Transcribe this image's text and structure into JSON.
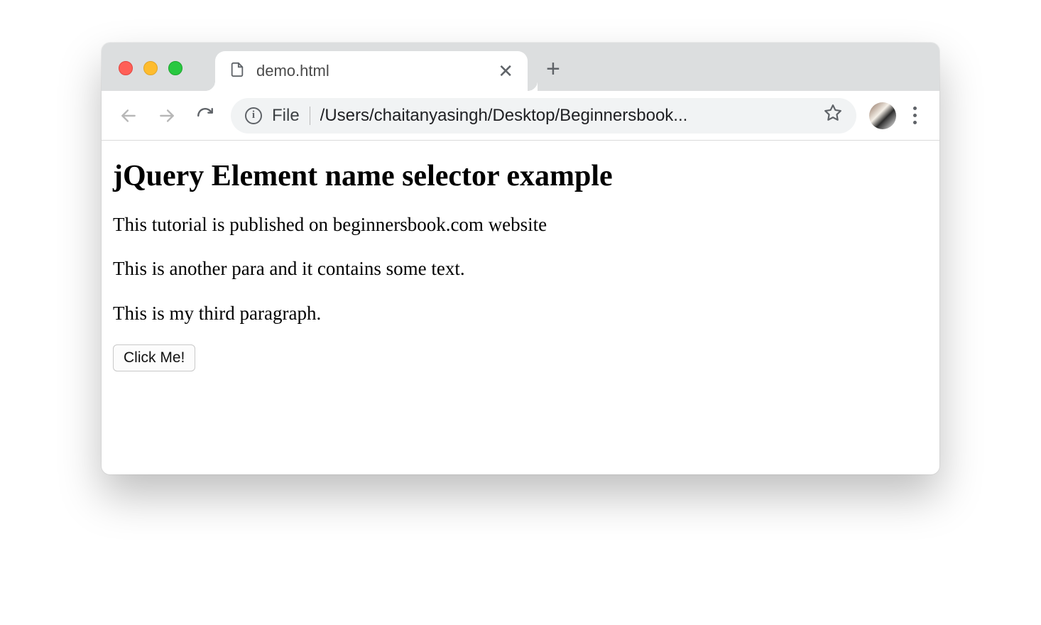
{
  "browser": {
    "tab": {
      "title": "demo.html"
    },
    "address": {
      "scheme": "File",
      "path": "/Users/chaitanyasingh/Desktop/Beginnersbook..."
    }
  },
  "page": {
    "heading": "jQuery Element name selector example",
    "paragraphs": [
      "This tutorial is published on beginnersbook.com website",
      "This is another para and it contains some text.",
      "This is my third paragraph."
    ],
    "button_label": "Click Me!"
  }
}
